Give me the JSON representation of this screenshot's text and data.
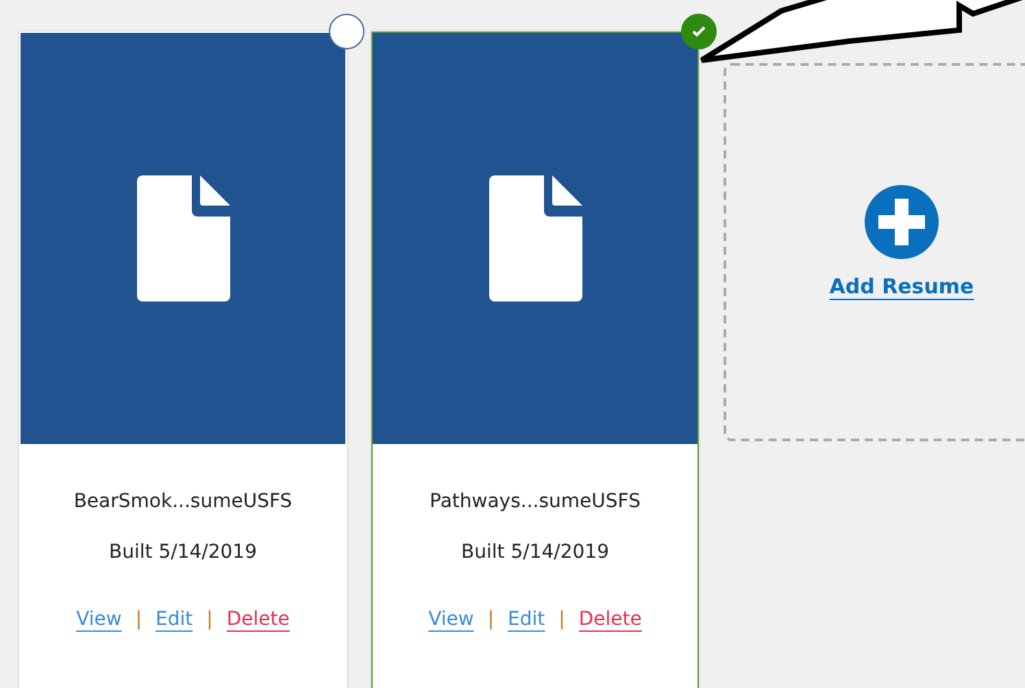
{
  "resumes": [
    {
      "name": "BearSmok...sumeUSFS",
      "built": "Built 5/14/2019",
      "selected": false,
      "actions": [
        {
          "label": "View",
          "kind": "view"
        },
        {
          "label": "Edit",
          "kind": "edit"
        },
        {
          "label": "Delete",
          "kind": "delete"
        }
      ],
      "separator": "|"
    },
    {
      "name": "Pathways...sumeUSFS",
      "built": "Built 5/14/2019",
      "selected": true,
      "actions": [
        {
          "label": "View",
          "kind": "view"
        },
        {
          "label": "Edit",
          "kind": "edit"
        },
        {
          "label": "Delete",
          "kind": "delete"
        }
      ],
      "separator": "|"
    }
  ],
  "add_card": {
    "label": "Add Resume"
  }
}
